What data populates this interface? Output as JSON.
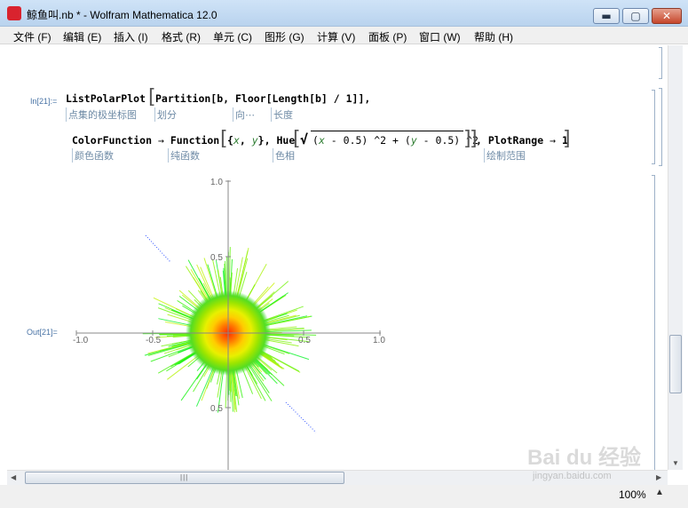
{
  "window": {
    "title": "鲸鱼叫.nb * - Wolfram Mathematica 12.0",
    "minimize_glyph": "▬",
    "maximize_glyph": "▢",
    "close_glyph": "✕"
  },
  "menu": [
    "文件 (F)",
    "编辑 (E)",
    "插入 (I)",
    "格式 (R)",
    "单元 (C)",
    "图形 (G)",
    "计算 (V)",
    "面板 (P)",
    "窗口 (W)",
    "帮助 (H)"
  ],
  "cells": {
    "in_label": "In[21]:=",
    "out_label": "Out[21]=",
    "line1": {
      "func": "ListPolarPlot",
      "arg": "Partition[b, Floor[Length[b] / 1]],",
      "hints": [
        "点集的极坐标图",
        "划分",
        "向⋯",
        "长度"
      ]
    },
    "line2": {
      "colorfunc": "ColorFunction",
      "arrow": "→",
      "function": "Function",
      "vars_open": "{",
      "x": "x",
      "comma": ", ",
      "y": "y",
      "vars_close": "},",
      "hue": "Hue",
      "sqrt": "√",
      "expr_open": "(",
      "expr_x": "x",
      "expr_mid": " - 0.5) ^2 + (",
      "expr_y": "y",
      "expr_end": " - 0.5) ^2",
      "plotrange": ", PlotRange",
      "arrow2": "→",
      "one": "1",
      "hints": [
        "颜色函数",
        "纯函数",
        "色相",
        "绘制范围"
      ]
    }
  },
  "plot": {
    "x_ticks": [
      "-1.0",
      "-0.5",
      "0.5",
      "1.0"
    ],
    "y_ticks": [
      "1.0",
      "0.5",
      "0.5"
    ]
  },
  "statusbar": {
    "zoom": "100%",
    "zoom_arrow": "▲"
  },
  "watermark": {
    "brand": "Bai du 经验",
    "url": "jingyan.baidu.com"
  }
}
